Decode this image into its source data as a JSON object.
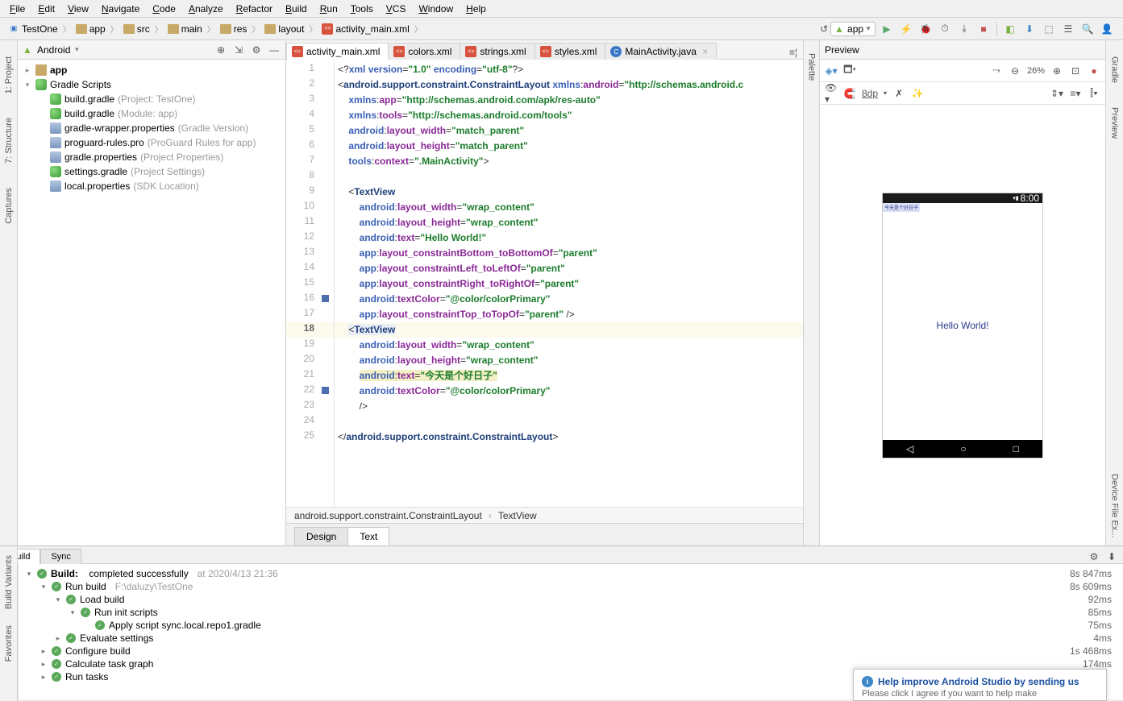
{
  "menu": [
    "File",
    "Edit",
    "View",
    "Navigate",
    "Code",
    "Analyze",
    "Refactor",
    "Build",
    "Run",
    "Tools",
    "VCS",
    "Window",
    "Help"
  ],
  "breadcrumb": [
    "TestOne",
    "app",
    "src",
    "main",
    "res",
    "layout",
    "activity_main.xml"
  ],
  "run_config": "app",
  "side_left": [
    "1: Project",
    "7: Structure",
    "Captures"
  ],
  "side_right": [
    "Gradle",
    "Preview",
    "Palette",
    "Device File Ex..."
  ],
  "project_panel": {
    "title": "Android",
    "tree": {
      "app": "app",
      "gradle_scripts": "Gradle Scripts",
      "items": [
        {
          "name": "build.gradle",
          "hint": "(Project: TestOne)",
          "icon": "gradle"
        },
        {
          "name": "build.gradle",
          "hint": "(Module: app)",
          "icon": "gradle"
        },
        {
          "name": "gradle-wrapper.properties",
          "hint": "(Gradle Version)",
          "icon": "prop"
        },
        {
          "name": "proguard-rules.pro",
          "hint": "(ProGuard Rules for app)",
          "icon": "prop"
        },
        {
          "name": "gradle.properties",
          "hint": "(Project Properties)",
          "icon": "prop"
        },
        {
          "name": "settings.gradle",
          "hint": "(Project Settings)",
          "icon": "gradle"
        },
        {
          "name": "local.properties",
          "hint": "(SDK Location)",
          "icon": "prop"
        }
      ]
    }
  },
  "tabs": [
    {
      "label": "activity_main.xml",
      "icon": "xml",
      "active": true
    },
    {
      "label": "colors.xml",
      "icon": "xml"
    },
    {
      "label": "strings.xml",
      "icon": "xml"
    },
    {
      "label": "styles.xml",
      "icon": "xml"
    },
    {
      "label": "MainActivity.java",
      "icon": "class",
      "closable": true
    }
  ],
  "editor_footer": {
    "crumb1": "android.support.constraint.ConstraintLayout",
    "crumb2": "TextView"
  },
  "bottom_tabs": {
    "design": "Design",
    "text": "Text"
  },
  "preview": {
    "title": "Preview",
    "zoom": "26%",
    "override": "8dp",
    "status_time": "8:00",
    "top_text": "今天是个好日子",
    "center_text": "Hello World!"
  },
  "code_lines": [
    {
      "n": 1,
      "html": "<span class='bracket'>&lt;?</span><span class='attr-ns'>xml version</span><span class='bracket'>=</span><span class='attr-val'>\"1.0\"</span> <span class='attr-ns'>encoding</span><span class='bracket'>=</span><span class='attr-val'>\"utf-8\"</span><span class='bracket'>?&gt;</span>"
    },
    {
      "n": 2,
      "html": "<span class='bracket'>&lt;</span><span class='tag'>android.support.constraint.ConstraintLayout</span> <span class='attr-ns'>xmlns</span><span class='bracket'>:</span><span class='attr-name'>android</span><span class='bracket'>=</span><span class='attr-val'>\"http://schemas.android.c</span>"
    },
    {
      "n": 3,
      "html": "    <span class='attr-ns'>xmlns</span><span class='bracket'>:</span><span class='attr-name'>app</span><span class='bracket'>=</span><span class='attr-val'>\"http://schemas.android.com/apk/res-auto\"</span>"
    },
    {
      "n": 4,
      "html": "    <span class='attr-ns'>xmlns</span><span class='bracket'>:</span><span class='attr-name'>tools</span><span class='bracket'>=</span><span class='attr-val'>\"http://schemas.android.com/tools\"</span>"
    },
    {
      "n": 5,
      "html": "    <span class='attr-ns'>android</span><span class='bracket'>:</span><span class='attr-name'>layout_width</span><span class='bracket'>=</span><span class='attr-val'>\"match_parent\"</span>"
    },
    {
      "n": 6,
      "html": "    <span class='attr-ns'>android</span><span class='bracket'>:</span><span class='attr-name'>layout_height</span><span class='bracket'>=</span><span class='attr-val'>\"match_parent\"</span>"
    },
    {
      "n": 7,
      "html": "    <span class='attr-ns'>tools</span><span class='bracket'>:</span><span class='attr-name'>context</span><span class='bracket'>=</span><span class='attr-val'>\".MainActivity\"</span><span class='bracket'>&gt;</span>"
    },
    {
      "n": 8,
      "html": ""
    },
    {
      "n": 9,
      "html": "    <span class='bracket'>&lt;</span><span class='tag'>TextView</span>"
    },
    {
      "n": 10,
      "html": "        <span class='attr-ns'>android</span><span class='bracket'>:</span><span class='attr-name'>layout_width</span><span class='bracket'>=</span><span class='attr-val'>\"wrap_content\"</span>"
    },
    {
      "n": 11,
      "html": "        <span class='attr-ns'>android</span><span class='bracket'>:</span><span class='attr-name'>layout_height</span><span class='bracket'>=</span><span class='attr-val'>\"wrap_content\"</span>"
    },
    {
      "n": 12,
      "html": "        <span class='attr-ns'>android</span><span class='bracket'>:</span><span class='attr-name'>text</span><span class='bracket'>=</span><span class='attr-val'>\"Hello World!\"</span>"
    },
    {
      "n": 13,
      "html": "        <span class='attr-ns'>app</span><span class='bracket'>:</span><span class='attr-name'>layout_constraintBottom_toBottomOf</span><span class='bracket'>=</span><span class='attr-val'>\"parent\"</span>"
    },
    {
      "n": 14,
      "html": "        <span class='attr-ns'>app</span><span class='bracket'>:</span><span class='attr-name'>layout_constraintLeft_toLeftOf</span><span class='bracket'>=</span><span class='attr-val'>\"parent\"</span>"
    },
    {
      "n": 15,
      "html": "        <span class='attr-ns'>app</span><span class='bracket'>:</span><span class='attr-name'>layout_constraintRight_toRightOf</span><span class='bracket'>=</span><span class='attr-val'>\"parent\"</span>"
    },
    {
      "n": 16,
      "html": "        <span class='attr-ns'>android</span><span class='bracket'>:</span><span class='attr-name'>textColor</span><span class='bracket'>=</span><span class='attr-val'>\"@color/colorPrimary\"</span>",
      "mark": true
    },
    {
      "n": 17,
      "html": "        <span class='attr-ns'>app</span><span class='bracket'>:</span><span class='attr-name'>layout_constraintTop_toTopOf</span><span class='bracket'>=</span><span class='attr-val'>\"parent\"</span> <span class='bracket'>/&gt;</span>"
    },
    {
      "n": 18,
      "html": "    <span class='hl'><span class='bracket'>&lt;</span><span class='tag'>TextView</span></span>",
      "current": true
    },
    {
      "n": 19,
      "html": "        <span class='attr-ns'>android</span><span class='bracket'>:</span><span class='attr-name'>layout_width</span><span class='bracket'>=</span><span class='attr-val'>\"wrap_content\"</span>"
    },
    {
      "n": 20,
      "html": "        <span class='attr-ns'>android</span><span class='bracket'>:</span><span class='attr-name'>layout_height</span><span class='bracket'>=</span><span class='attr-val'>\"wrap_content\"</span>"
    },
    {
      "n": 21,
      "html": "        <span style='background:#f3efc5'><span class='attr-ns'>android</span><span class='bracket'>:</span><span class='attr-name'>text</span><span class='bracket'>=</span><span class='attr-val'>\"今天是个好日子\"</span></span>"
    },
    {
      "n": 22,
      "html": "        <span class='attr-ns'>android</span><span class='bracket'>:</span><span class='attr-name'>textColor</span><span class='bracket'>=</span><span class='attr-val'>\"@color/colorPrimary\"</span>",
      "mark": true
    },
    {
      "n": 23,
      "html": "        <span class='bracket'>/&gt;</span>"
    },
    {
      "n": 24,
      "html": ""
    },
    {
      "n": 25,
      "html": "<span class='bracket'>&lt;/</span><span class='tag'>android.support.constraint.ConstraintLayout</span><span class='bracket'>&gt;</span>"
    }
  ],
  "build": {
    "tabs": {
      "build": "Build",
      "sync": "Sync"
    },
    "root": {
      "label": "Build:",
      "msg": "completed successfully",
      "ts": "at 2020/4/13 21:36",
      "dur": "8s 847ms"
    },
    "rows": [
      {
        "indent": 1,
        "arrow": "▾",
        "label": "Run build",
        "hint": "F:\\daluzy\\TestOne",
        "dur": "8s 609ms"
      },
      {
        "indent": 2,
        "arrow": "▾",
        "label": "Load build",
        "dur": "92ms"
      },
      {
        "indent": 3,
        "arrow": "▾",
        "label": "Run init scripts",
        "dur": "85ms"
      },
      {
        "indent": 4,
        "arrow": "",
        "label": "Apply script sync.local.repo1.gradle",
        "dur": "75ms"
      },
      {
        "indent": 2,
        "arrow": "▸",
        "label": "Evaluate settings",
        "dur": "4ms"
      },
      {
        "indent": 1,
        "arrow": "▸",
        "label": "Configure build",
        "dur": "1s 468ms"
      },
      {
        "indent": 1,
        "arrow": "▸",
        "label": "Calculate task graph",
        "dur": "174ms"
      },
      {
        "indent": 1,
        "arrow": "▸",
        "label": "Run tasks",
        "dur": ""
      }
    ]
  },
  "help": {
    "title": "Help improve Android Studio by sending us",
    "detail": "Please click I agree if you want to help make"
  },
  "bottom_tool_labels": {
    "bv": "Build Variants",
    "fav": "Favorites"
  }
}
